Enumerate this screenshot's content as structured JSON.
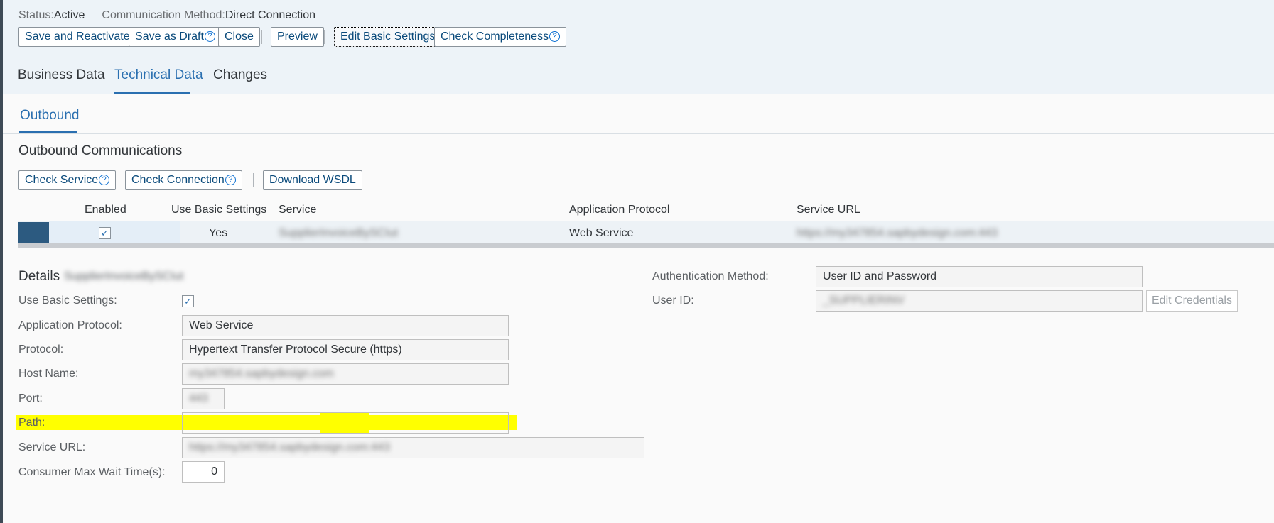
{
  "status": {
    "status_label": "Status:",
    "status_value": "Active",
    "method_label": "Communication Method:",
    "method_value": "Direct Connection"
  },
  "toolbar": {
    "save_reactivate": "Save and Reactivate",
    "save_draft": "Save as Draft",
    "close": "Close",
    "preview": "Preview",
    "edit_basic_settings": "Edit Basic Settings",
    "check_completeness": "Check Completeness",
    "help_glyph": "?"
  },
  "tabs": [
    "Business Data",
    "Technical Data",
    "Changes"
  ],
  "active_tab": "Technical Data",
  "subtab": "Outbound",
  "outbound": {
    "section_title": "Outbound Communications",
    "check_service": "Check Service",
    "check_connection": "Check Connection",
    "download_wsdl": "Download WSDL",
    "columns": [
      "Enabled",
      "Use Basic Settings",
      "Service",
      "Application Protocol",
      "Service URL"
    ],
    "row": {
      "enabled": true,
      "use_basic_settings": "Yes",
      "service": "SupplierInvoiceBySCIut",
      "application_protocol": "Web Service",
      "service_url": "https://my347854.sapbydesign.com:443"
    }
  },
  "details": {
    "title": "Details",
    "title_suffix": "SupplierInvoiceBySCIut",
    "use_basic_settings_label": "Use Basic Settings:",
    "application_protocol_label": "Application Protocol:",
    "application_protocol": "Web Service",
    "protocol_label": "Protocol:",
    "protocol": "Hypertext Transfer Protocol Secure (https)",
    "host_name_label": "Host Name:",
    "host_name": "my347854.sapbydesign.com",
    "port_label": "Port:",
    "port": "443",
    "path_label": "Path:",
    "path": "",
    "service_url_label": "Service URL:",
    "service_url": "https://my347854.sapbydesign.com:443",
    "max_wait_label": "Consumer Max Wait Time(s):",
    "max_wait": "0"
  },
  "auth": {
    "method_label": "Authentication Method:",
    "method": "User ID and Password",
    "user_id_label": "User ID:",
    "user_id": "_SUPPLIERINV",
    "edit_credentials": "Edit Credentials"
  },
  "colors": {
    "accent": "#2a6fb0",
    "header_bg": "#edf3f8",
    "highlight": "#ffff00",
    "selected_row": "#2c5a80"
  }
}
